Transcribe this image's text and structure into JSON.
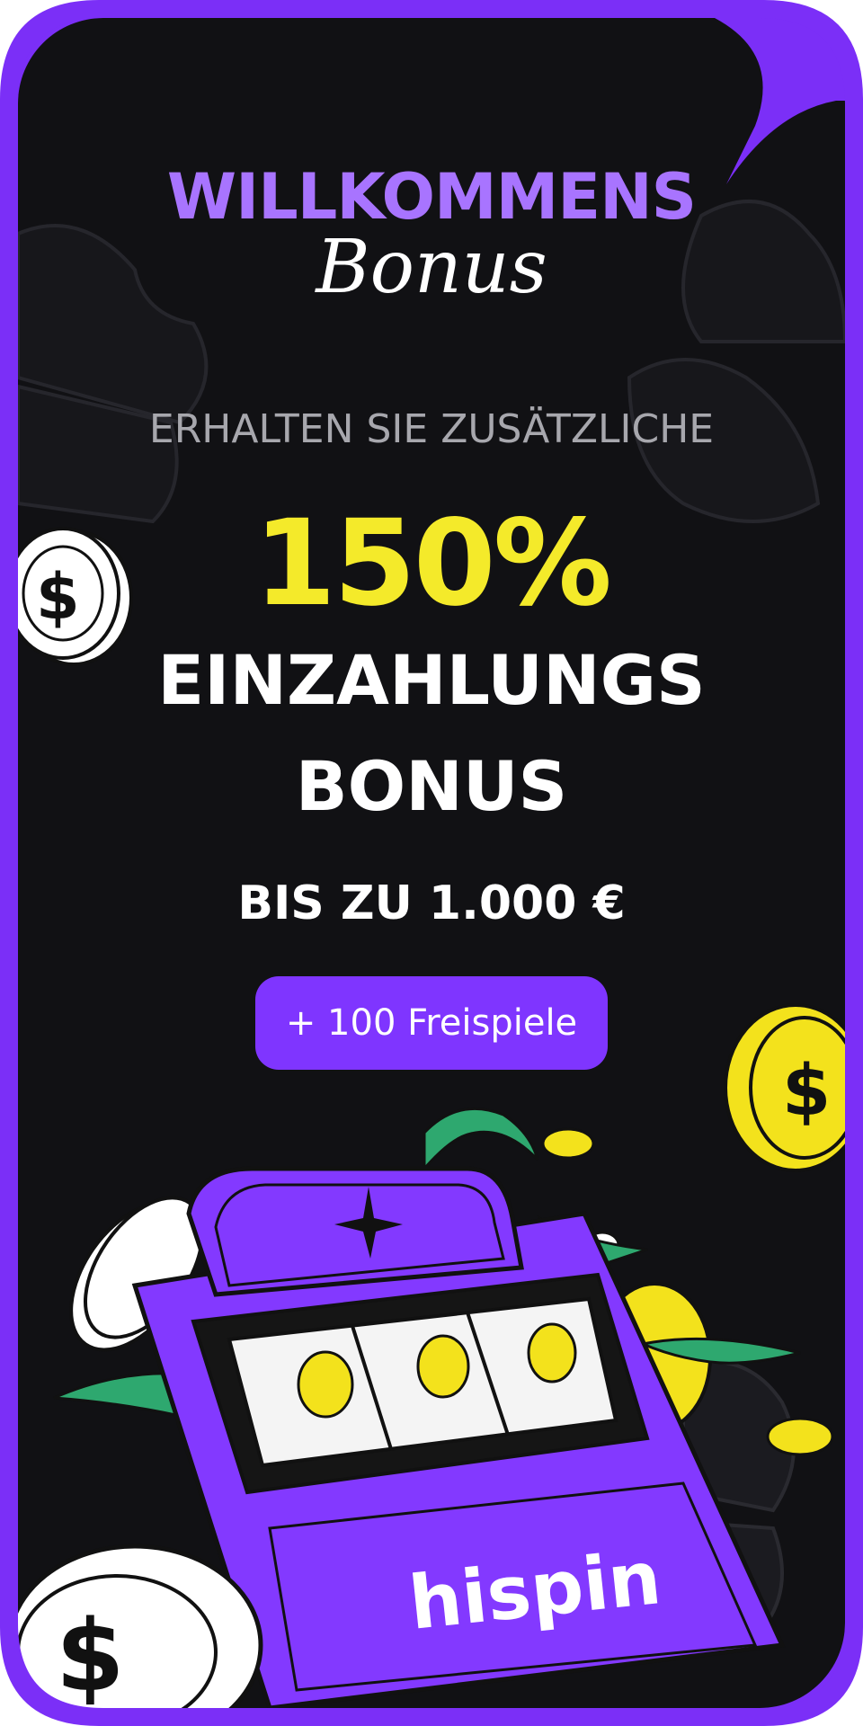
{
  "banner": {
    "title": "WILLKOMMENS",
    "title_script": "Bonus",
    "subtitle": "ERHALTEN SIE ZUSÄTZLICHE",
    "percent": "150%",
    "line1": "EINZAHLUNGS",
    "line2": "BONUS",
    "limit": "BIS ZU 1.000 €",
    "cta_label": "+ 100 Freispiele",
    "logo_text": "hispin"
  },
  "colors": {
    "frame": "#7b2ff7",
    "background": "#111114",
    "title_purple": "#a874ff",
    "percent_yellow": "#f4ea2a",
    "button_purple": "#7f35ff"
  },
  "icons": [
    "clover-icon",
    "coin-icon",
    "slot-machine-icon",
    "lemon-icon",
    "sparkle-icon",
    "leaf-icon"
  ]
}
